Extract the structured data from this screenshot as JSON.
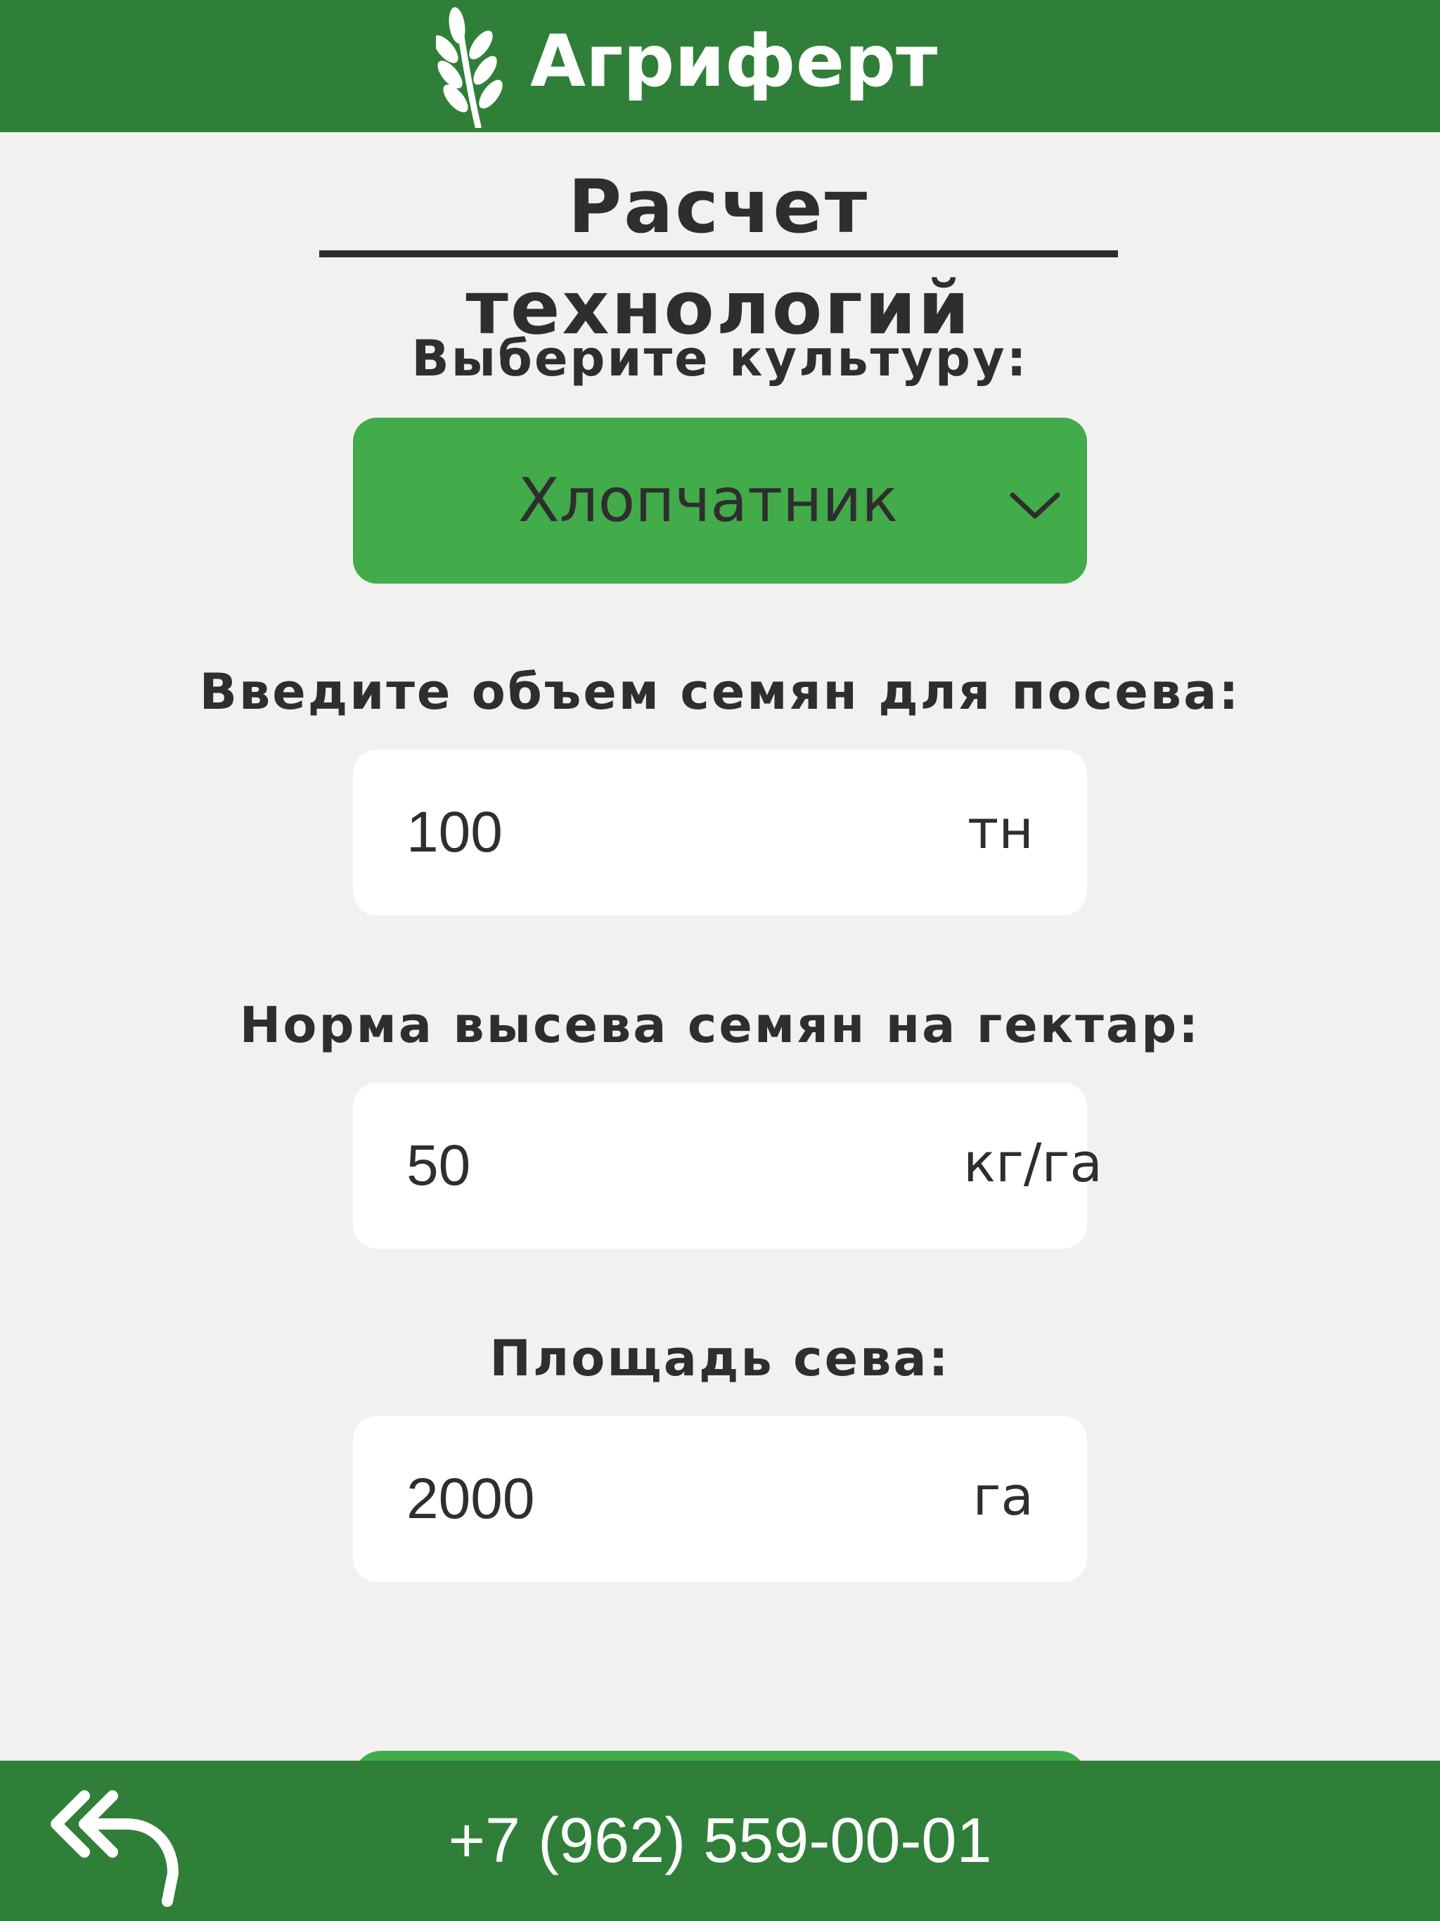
{
  "header": {
    "brand": "Агриферт",
    "logo_icon": "wheat-icon",
    "background": "#2f7f38"
  },
  "page_title": "Расчет технологий",
  "crop": {
    "label": "Выберите культуру:",
    "value": "Хлопчатник",
    "dropdown_icon": "chevron-down-icon",
    "background": "#42ab4a"
  },
  "seed_volume": {
    "label": "Введите объем семян для посева:",
    "value": "100",
    "unit": "тн"
  },
  "seeding_rate": {
    "label": "Норма высева семян на гектар:",
    "value": "50",
    "unit": "кг/га"
  },
  "sowing_area": {
    "label": "Площадь сева:",
    "value": "2000",
    "unit": "га"
  },
  "footer": {
    "back_icon": "double-back-arrow-icon",
    "phone": "+7 (962) 559-00-01"
  }
}
